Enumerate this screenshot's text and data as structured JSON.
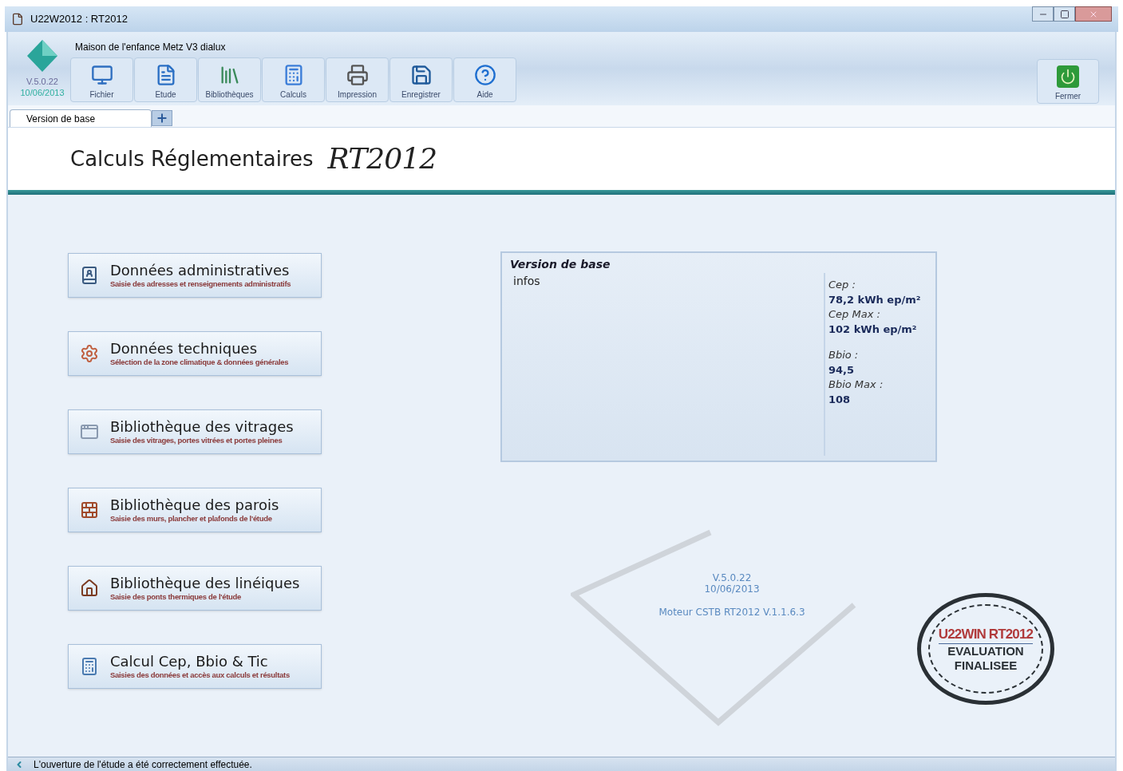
{
  "window": {
    "title": "U22W2012 : RT2012"
  },
  "app": {
    "version": "V.5.0.22",
    "date": "10/06/2013"
  },
  "project_name": "Maison de l'enfance Metz V3 dialux",
  "toolbar": [
    {
      "label": "Fichier",
      "kind": "file"
    },
    {
      "label": "Etude",
      "kind": "study"
    },
    {
      "label": "Bibliothèques",
      "kind": "library"
    },
    {
      "label": "Calculs",
      "kind": "calc"
    },
    {
      "label": "Impression",
      "kind": "print"
    },
    {
      "label": "Enregistrer",
      "kind": "save"
    },
    {
      "label": "Aide",
      "kind": "help"
    }
  ],
  "close_button": {
    "label": "Fermer"
  },
  "tabs": [
    {
      "label": "Version de base",
      "selected": true
    }
  ],
  "header": {
    "title": "Calculs Réglementaires",
    "logo": "RT2012"
  },
  "modules": [
    {
      "title": "Données administratives",
      "subtitle": "Saisie des adresses et renseignements administratifs",
      "kind": "admin"
    },
    {
      "title": "Données techniques",
      "subtitle": "Sélection de la zone climatique & données générales",
      "kind": "tech"
    },
    {
      "title": "Bibliothèque des vitrages",
      "subtitle": "Saisie des vitrages, portes vitrées et portes pleines",
      "kind": "window"
    },
    {
      "title": "Bibliothèque des parois",
      "subtitle": "Saisie des murs, plancher et plafonds de l'étude",
      "kind": "wall"
    },
    {
      "title": "Bibliothèque des linéiques",
      "subtitle": "Saisie des ponts thermiques de l'étude",
      "kind": "house"
    },
    {
      "title": "Calcul Cep, Bbio & Tic",
      "subtitle": "Saisies des données et accès aux calculs et résultats",
      "kind": "calc"
    }
  ],
  "summary": {
    "title": "Version de base",
    "infos": "infos",
    "groups": [
      {
        "items": [
          {
            "label": "Cep :",
            "value": "78,2 kWh ep/m²"
          },
          {
            "label": "Cep Max :",
            "value": "102 kWh ep/m²"
          }
        ]
      },
      {
        "items": [
          {
            "label": "Bbio :",
            "value": "94,5"
          },
          {
            "label": "Bbio Max :",
            "value": "108"
          }
        ]
      }
    ]
  },
  "about": {
    "version": "V.5.0.22",
    "date": "10/06/2013",
    "engine": "Moteur CSTB RT2012 V.1.1.6.3"
  },
  "stamp": {
    "brand": "U22WIN RT2012",
    "lines": [
      "EVALUATION",
      "FINALISEE"
    ]
  },
  "status_bar": {
    "message": "L'ouverture de l'étude a été correctement effectuée."
  }
}
